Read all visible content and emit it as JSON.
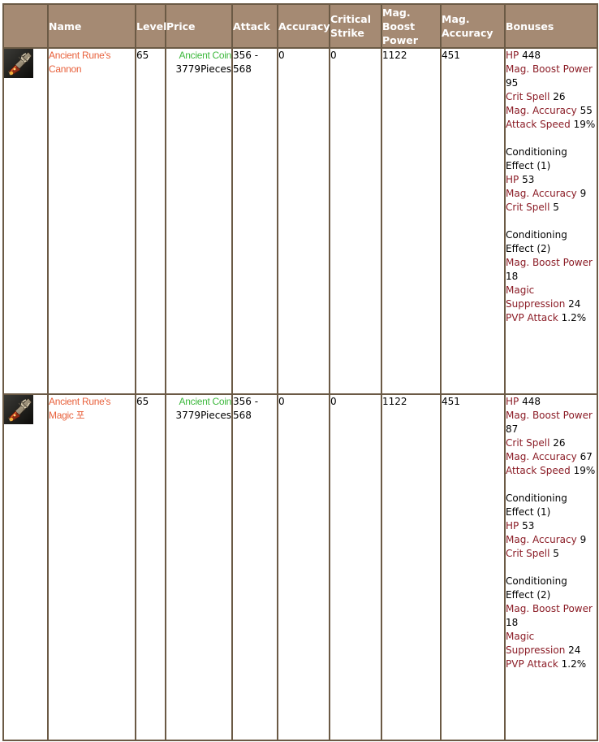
{
  "table": {
    "headers": {
      "icon": "",
      "name": "Name",
      "level": "Level",
      "price": "Price",
      "attack": "Attack",
      "accuracy": "Accuracy",
      "critical_strike": "Critical Strike",
      "mag_boost_power": "Mag. Boost Power",
      "mag_accuracy": "Mag. Accuracy",
      "bonuses": "Bonuses"
    },
    "rows": [
      {
        "icon": "rune-cannon-icon",
        "name": "Ancient Rune's Cannon",
        "level": "65",
        "price_currency": "Ancient Coin",
        "price_amount": "3779Pieces",
        "attack": "356 - 568",
        "accuracy": "0",
        "critical_strike": "0",
        "mag_boost_power": "1122",
        "mag_accuracy": "451",
        "bonuses": [
          {
            "label": "HP",
            "value": "448"
          },
          {
            "label": "Mag. Boost Power",
            "value": "95"
          },
          {
            "label": "Crit Spell",
            "value": "26"
          },
          {
            "label": "Mag. Accuracy",
            "value": "55"
          },
          {
            "label": "Attack Speed",
            "value": "19%"
          }
        ],
        "conditioning": [
          {
            "title": "Conditioning Effect (1)",
            "effects": [
              {
                "label": "HP",
                "value": "53"
              },
              {
                "label": "Mag. Accuracy",
                "value": "9"
              },
              {
                "label": "Crit Spell",
                "value": "5"
              }
            ]
          },
          {
            "title": "Conditioning Effect (2)",
            "effects": [
              {
                "label": "Mag. Boost Power",
                "value": "18"
              },
              {
                "label": "Magic Suppression",
                "value": "24"
              },
              {
                "label": "PVP Attack",
                "value": "1.2%"
              }
            ]
          }
        ]
      },
      {
        "icon": "rune-cannon-icon",
        "name": "Ancient Rune's Magic 포",
        "level": "65",
        "price_currency": "Ancient Coin",
        "price_amount": "3779Pieces",
        "attack": "356 - 568",
        "accuracy": "0",
        "critical_strike": "0",
        "mag_boost_power": "1122",
        "mag_accuracy": "451",
        "bonuses": [
          {
            "label": "HP",
            "value": "448"
          },
          {
            "label": "Mag. Boost Power",
            "value": "87"
          },
          {
            "label": "Crit Spell",
            "value": "26"
          },
          {
            "label": "Mag. Accuracy",
            "value": "67"
          },
          {
            "label": "Attack Speed",
            "value": "19%"
          }
        ],
        "conditioning": [
          {
            "title": "Conditioning Effect (1)",
            "effects": [
              {
                "label": "HP",
                "value": "53"
              },
              {
                "label": "Mag. Accuracy",
                "value": "9"
              },
              {
                "label": "Crit Spell",
                "value": "5"
              }
            ]
          },
          {
            "title": "Conditioning Effect (2)",
            "effects": [
              {
                "label": "Mag. Boost Power",
                "value": "18"
              },
              {
                "label": "Magic Suppression",
                "value": "24"
              },
              {
                "label": "PVP Attack",
                "value": "1.2%"
              }
            ]
          }
        ]
      }
    ]
  },
  "colors": {
    "header_bg": "#a58a73",
    "border": "#6b5a45",
    "item_name": "#e8613c",
    "currency": "#3db83d",
    "bonus_label": "#8b1c26"
  }
}
